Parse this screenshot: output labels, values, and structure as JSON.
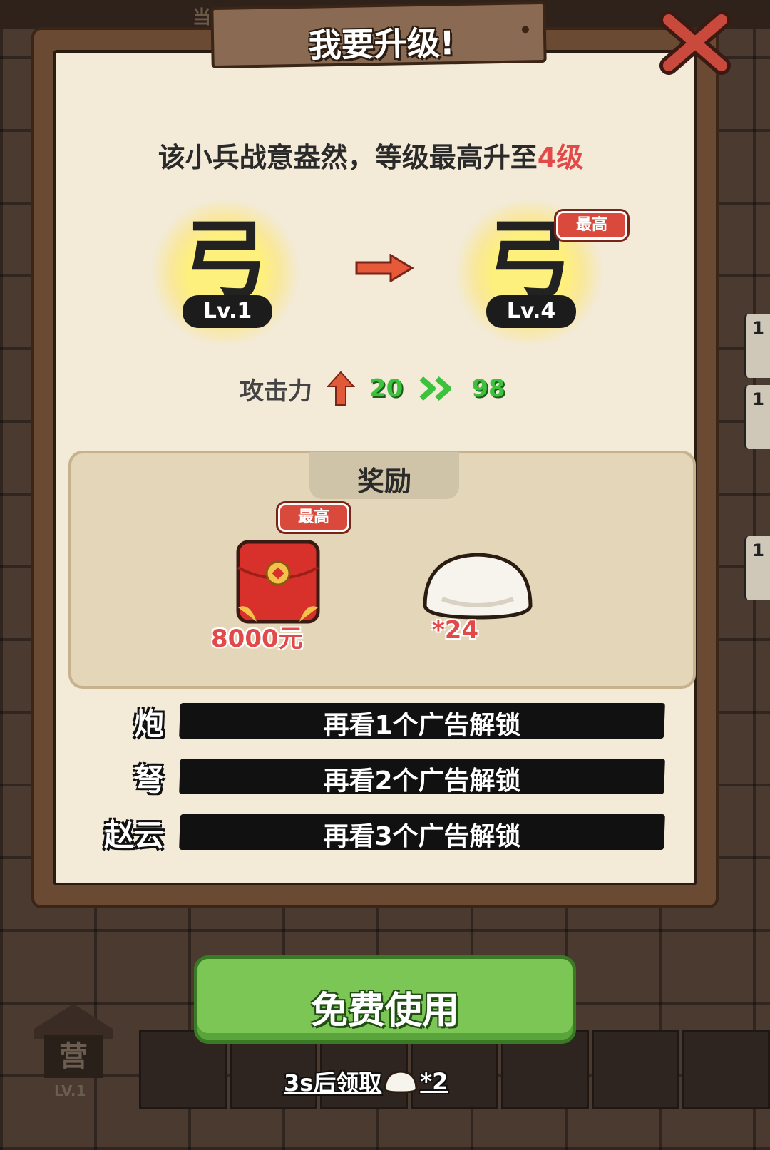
{
  "background": {
    "top_text": "当",
    "side_cards": [
      "1",
      "1",
      "1"
    ],
    "camp": {
      "glyph": "营",
      "level": "LV.1"
    }
  },
  "modal": {
    "title": "我要升级!",
    "description_prefix": "该小兵战意盎然，等级最高升至",
    "description_highlight": "4级",
    "unit": {
      "glyph": "弓",
      "from_level": "Lv.1",
      "to_level": "Lv.4",
      "max_badge": "最高"
    },
    "stat": {
      "label": "攻击力",
      "from": "20",
      "to": "98"
    },
    "reward": {
      "title": "奖励",
      "items": [
        {
          "icon": "red-envelope-icon",
          "badge": "最高",
          "amount": "8000元"
        },
        {
          "icon": "steamed-bun-icon",
          "amount": "*24"
        }
      ]
    },
    "unlocks": [
      {
        "name": "炮",
        "text": "再看1个广告解锁"
      },
      {
        "name": "弩",
        "text": "再看2个广告解锁"
      },
      {
        "name": "赵云",
        "text": "再看3个广告解锁"
      }
    ]
  },
  "actions": {
    "free_use": "免费使用",
    "claim_text": "3s后领取",
    "claim_count": "*2"
  },
  "colors": {
    "highlight_red": "#e24a4a",
    "stat_green": "#3cc23c",
    "button_green": "#7cc655",
    "panel_bg": "#f3ead8"
  }
}
